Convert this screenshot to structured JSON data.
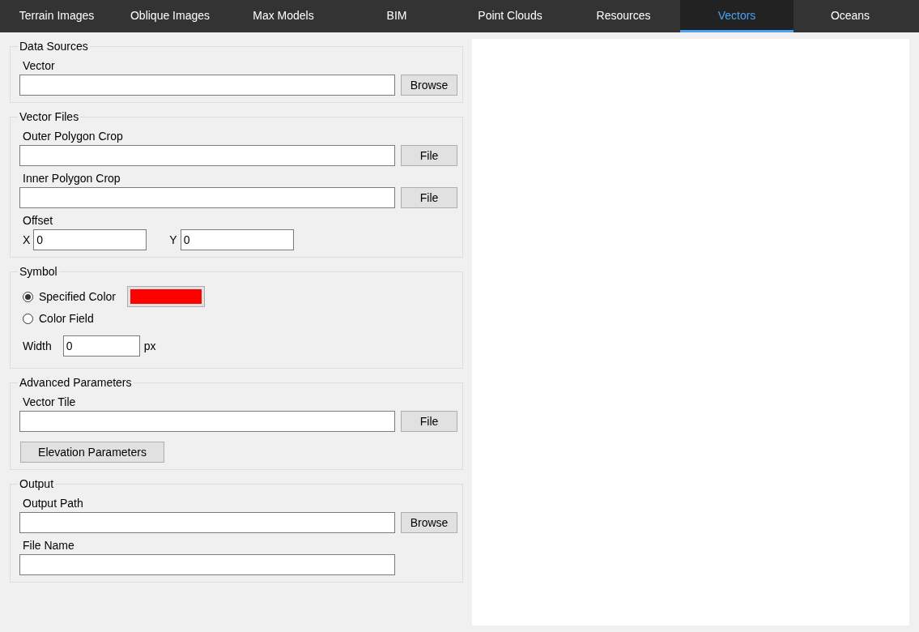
{
  "tabs": [
    {
      "label": "Terrain Images",
      "selected": false
    },
    {
      "label": "Oblique Images",
      "selected": false
    },
    {
      "label": "Max Models",
      "selected": false
    },
    {
      "label": "BIM",
      "selected": false
    },
    {
      "label": "Point Clouds",
      "selected": false
    },
    {
      "label": "Resources",
      "selected": false
    },
    {
      "label": "Vectors",
      "selected": true
    },
    {
      "label": "Oceans",
      "selected": false
    }
  ],
  "sections": [
    {
      "title": "Data Sources",
      "rows": [
        {
          "kind": "label",
          "text": "Vector"
        },
        {
          "kind": "field_button",
          "value": "",
          "button": "Browse"
        }
      ]
    },
    {
      "title": "Vector Files",
      "rows": [
        {
          "kind": "label",
          "text": "Outer Polygon Crop"
        },
        {
          "kind": "field_button",
          "button": "File"
        },
        {
          "kind": "label",
          "text": "Inner Polygon Crop"
        },
        {
          "kind": "field_button",
          "button": "File"
        },
        {
          "kind": "label",
          "text": "Offset"
        },
        {
          "kind": "offset",
          "x_label": "X",
          "x_value": "0",
          "y_label": "Y",
          "y_value": "0"
        }
      ]
    },
    {
      "title": "Symbol",
      "rows": [
        {
          "kind": "radio",
          "label": "Specified Color",
          "selected": true,
          "color": "#ff0000"
        },
        {
          "kind": "radio",
          "label": "Color Field",
          "selected": false
        },
        {
          "kind": "width",
          "label": "Width",
          "value": "0",
          "unit": "px"
        }
      ]
    },
    {
      "title": "Advanced Parameters",
      "rows": [
        {
          "kind": "label",
          "text": "Vector Tile"
        },
        {
          "kind": "field_button",
          "button": "File"
        },
        {
          "kind": "button",
          "text": "Elevation Parameters"
        }
      ]
    },
    {
      "title": "Output",
      "rows": [
        {
          "kind": "label",
          "text": "Output Path"
        },
        {
          "kind": "field_button",
          "button": "Browse"
        },
        {
          "kind": "label",
          "text": "File Name"
        },
        {
          "kind": "field"
        }
      ]
    }
  ]
}
